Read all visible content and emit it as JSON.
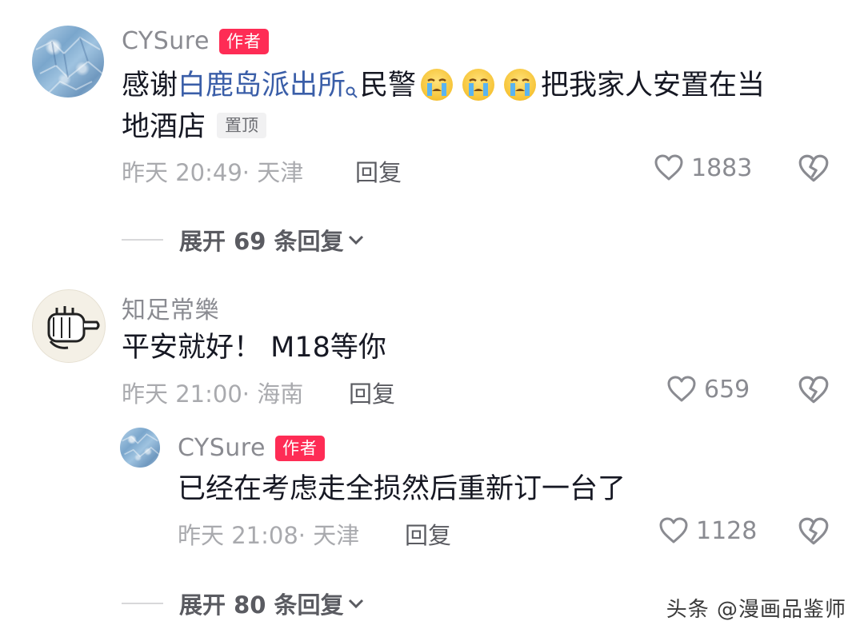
{
  "comments": [
    {
      "username": "CYSure",
      "author_tag": "作者",
      "text_prefix": "感谢",
      "link_text": "白鹿岛派出所",
      "text_mid": "民警",
      "text_suffix": "把我家人安置在当",
      "text_line2": "地酒店",
      "pin_tag": "置顶",
      "meta": "昨天 20:49· 天津",
      "reply_label": "回复",
      "likes": "1883",
      "expand_label": "展开 69 条回复",
      "avatar": "ice-texture-avatar"
    },
    {
      "username": "知足常樂",
      "text": "平安就好！ M18等你",
      "meta": "昨天 21:00· 海南",
      "reply_label": "回复",
      "likes": "659",
      "avatar": "pointing-fist-avatar",
      "replies": [
        {
          "username": "CYSure",
          "author_tag": "作者",
          "text": "已经在考虑走全损然后重新订一台了",
          "meta": "昨天 21:08· 天津",
          "reply_label": "回复",
          "likes": "1128",
          "avatar": "ice-texture-avatar"
        }
      ],
      "expand_label": "展开 80 条回复"
    }
  ],
  "icons": [
    "heart-icon",
    "broken-heart-icon",
    "chevron-down-icon",
    "search-icon",
    "crying-emoji-icon"
  ],
  "watermark": "头条 @漫画品鉴师",
  "colors": {
    "author_tag": "#fe2c55",
    "link": "#3a5ea8",
    "meta": "#a9aaae"
  }
}
